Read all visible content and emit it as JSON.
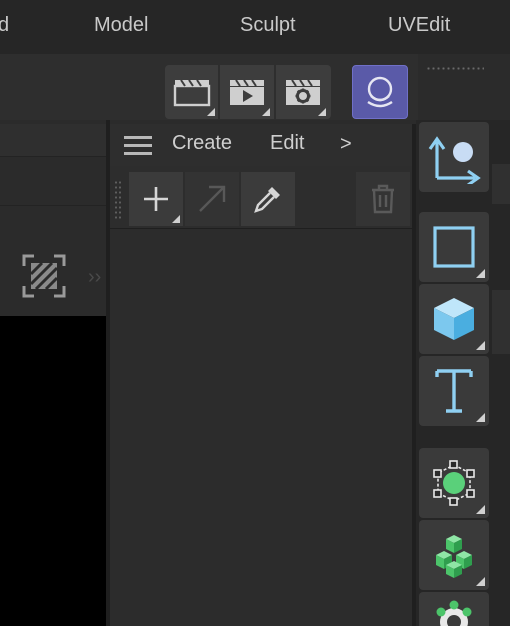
{
  "menu": {
    "items": [
      "d",
      "Model",
      "Sculpt",
      "UVEdit"
    ]
  },
  "toolbar": {
    "icons": [
      "clapperboard-icon",
      "render-play-icon",
      "render-settings-icon",
      "sphere-icon"
    ]
  },
  "panel": {
    "create_label": "Create",
    "edit_label": "Edit",
    "more_label": ">"
  },
  "right_tools": {
    "icons": [
      "coordinate-axes-icon",
      "rectangle-icon",
      "cube-icon",
      "text-icon",
      "selection-object-icon",
      "mograph-cubes-icon",
      "gear-flower-icon"
    ]
  },
  "colors": {
    "accent_blue": "#5a5aa8",
    "icon_light_blue": "#8fd0f2",
    "icon_green": "#4cc46a",
    "background": "#2b2b2b"
  }
}
